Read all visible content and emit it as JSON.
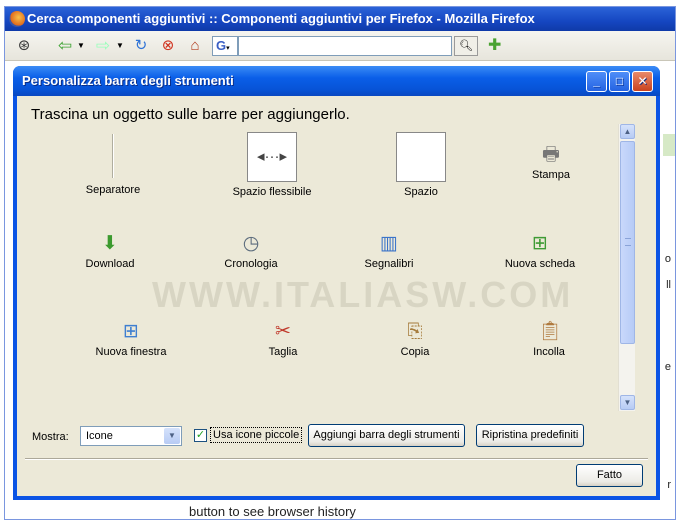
{
  "browser": {
    "title": "Cerca componenti aggiuntivi :: Componenti aggiuntivi per Firefox - Mozilla Firefox",
    "search_engine_letter": "G",
    "search_value": "",
    "background_text": "button to see browser history",
    "background_side_letters": [
      "o",
      "ll",
      "e",
      "r"
    ]
  },
  "dialog": {
    "title": "Personalizza barra degli strumenti",
    "hint": "Trascina un oggetto sulle barre per aggiungerlo.",
    "watermark": "WWW.ITALIASW.COM",
    "items": [
      {
        "label": "Separatore",
        "icon": "separator-icon"
      },
      {
        "label": "Spazio flessibile",
        "icon": "flexible-space-icon"
      },
      {
        "label": "Spazio",
        "icon": "space-icon"
      },
      {
        "label": "Stampa",
        "icon": "print-icon"
      },
      {
        "label": "Download",
        "icon": "download-icon"
      },
      {
        "label": "Cronologia",
        "icon": "history-icon"
      },
      {
        "label": "Segnalibri",
        "icon": "bookmarks-icon"
      },
      {
        "label": "Nuova scheda",
        "icon": "new-tab-icon"
      },
      {
        "label": "Nuova finestra",
        "icon": "new-window-icon"
      },
      {
        "label": "Taglia",
        "icon": "cut-icon"
      },
      {
        "label": "Copia",
        "icon": "copy-icon"
      },
      {
        "label": "Incolla",
        "icon": "paste-icon"
      }
    ],
    "mostra_label": "Mostra:",
    "mostra_value": "Icone",
    "small_icons_label": "Usa icone piccole",
    "small_icons_checked": true,
    "add_toolbar_label": "Aggiungi barra degli strumenti",
    "restore_label": "Ripristina predefiniti",
    "done_label": "Fatto"
  }
}
